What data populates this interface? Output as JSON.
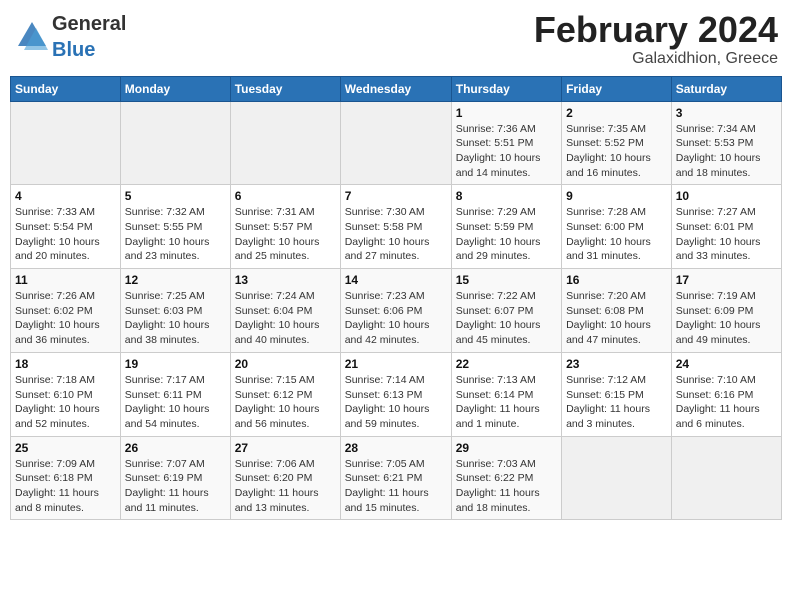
{
  "header": {
    "logo_general": "General",
    "logo_blue": "Blue",
    "month_year": "February 2024",
    "location": "Galaxidhion, Greece"
  },
  "days_of_week": [
    "Sunday",
    "Monday",
    "Tuesday",
    "Wednesday",
    "Thursday",
    "Friday",
    "Saturday"
  ],
  "weeks": [
    [
      {
        "day": "",
        "info": ""
      },
      {
        "day": "",
        "info": ""
      },
      {
        "day": "",
        "info": ""
      },
      {
        "day": "",
        "info": ""
      },
      {
        "day": "1",
        "info": "Sunrise: 7:36 AM\nSunset: 5:51 PM\nDaylight: 10 hours\nand 14 minutes."
      },
      {
        "day": "2",
        "info": "Sunrise: 7:35 AM\nSunset: 5:52 PM\nDaylight: 10 hours\nand 16 minutes."
      },
      {
        "day": "3",
        "info": "Sunrise: 7:34 AM\nSunset: 5:53 PM\nDaylight: 10 hours\nand 18 minutes."
      }
    ],
    [
      {
        "day": "4",
        "info": "Sunrise: 7:33 AM\nSunset: 5:54 PM\nDaylight: 10 hours\nand 20 minutes."
      },
      {
        "day": "5",
        "info": "Sunrise: 7:32 AM\nSunset: 5:55 PM\nDaylight: 10 hours\nand 23 minutes."
      },
      {
        "day": "6",
        "info": "Sunrise: 7:31 AM\nSunset: 5:57 PM\nDaylight: 10 hours\nand 25 minutes."
      },
      {
        "day": "7",
        "info": "Sunrise: 7:30 AM\nSunset: 5:58 PM\nDaylight: 10 hours\nand 27 minutes."
      },
      {
        "day": "8",
        "info": "Sunrise: 7:29 AM\nSunset: 5:59 PM\nDaylight: 10 hours\nand 29 minutes."
      },
      {
        "day": "9",
        "info": "Sunrise: 7:28 AM\nSunset: 6:00 PM\nDaylight: 10 hours\nand 31 minutes."
      },
      {
        "day": "10",
        "info": "Sunrise: 7:27 AM\nSunset: 6:01 PM\nDaylight: 10 hours\nand 33 minutes."
      }
    ],
    [
      {
        "day": "11",
        "info": "Sunrise: 7:26 AM\nSunset: 6:02 PM\nDaylight: 10 hours\nand 36 minutes."
      },
      {
        "day": "12",
        "info": "Sunrise: 7:25 AM\nSunset: 6:03 PM\nDaylight: 10 hours\nand 38 minutes."
      },
      {
        "day": "13",
        "info": "Sunrise: 7:24 AM\nSunset: 6:04 PM\nDaylight: 10 hours\nand 40 minutes."
      },
      {
        "day": "14",
        "info": "Sunrise: 7:23 AM\nSunset: 6:06 PM\nDaylight: 10 hours\nand 42 minutes."
      },
      {
        "day": "15",
        "info": "Sunrise: 7:22 AM\nSunset: 6:07 PM\nDaylight: 10 hours\nand 45 minutes."
      },
      {
        "day": "16",
        "info": "Sunrise: 7:20 AM\nSunset: 6:08 PM\nDaylight: 10 hours\nand 47 minutes."
      },
      {
        "day": "17",
        "info": "Sunrise: 7:19 AM\nSunset: 6:09 PM\nDaylight: 10 hours\nand 49 minutes."
      }
    ],
    [
      {
        "day": "18",
        "info": "Sunrise: 7:18 AM\nSunset: 6:10 PM\nDaylight: 10 hours\nand 52 minutes."
      },
      {
        "day": "19",
        "info": "Sunrise: 7:17 AM\nSunset: 6:11 PM\nDaylight: 10 hours\nand 54 minutes."
      },
      {
        "day": "20",
        "info": "Sunrise: 7:15 AM\nSunset: 6:12 PM\nDaylight: 10 hours\nand 56 minutes."
      },
      {
        "day": "21",
        "info": "Sunrise: 7:14 AM\nSunset: 6:13 PM\nDaylight: 10 hours\nand 59 minutes."
      },
      {
        "day": "22",
        "info": "Sunrise: 7:13 AM\nSunset: 6:14 PM\nDaylight: 11 hours\nand 1 minute."
      },
      {
        "day": "23",
        "info": "Sunrise: 7:12 AM\nSunset: 6:15 PM\nDaylight: 11 hours\nand 3 minutes."
      },
      {
        "day": "24",
        "info": "Sunrise: 7:10 AM\nSunset: 6:16 PM\nDaylight: 11 hours\nand 6 minutes."
      }
    ],
    [
      {
        "day": "25",
        "info": "Sunrise: 7:09 AM\nSunset: 6:18 PM\nDaylight: 11 hours\nand 8 minutes."
      },
      {
        "day": "26",
        "info": "Sunrise: 7:07 AM\nSunset: 6:19 PM\nDaylight: 11 hours\nand 11 minutes."
      },
      {
        "day": "27",
        "info": "Sunrise: 7:06 AM\nSunset: 6:20 PM\nDaylight: 11 hours\nand 13 minutes."
      },
      {
        "day": "28",
        "info": "Sunrise: 7:05 AM\nSunset: 6:21 PM\nDaylight: 11 hours\nand 15 minutes."
      },
      {
        "day": "29",
        "info": "Sunrise: 7:03 AM\nSunset: 6:22 PM\nDaylight: 11 hours\nand 18 minutes."
      },
      {
        "day": "",
        "info": ""
      },
      {
        "day": "",
        "info": ""
      }
    ]
  ]
}
